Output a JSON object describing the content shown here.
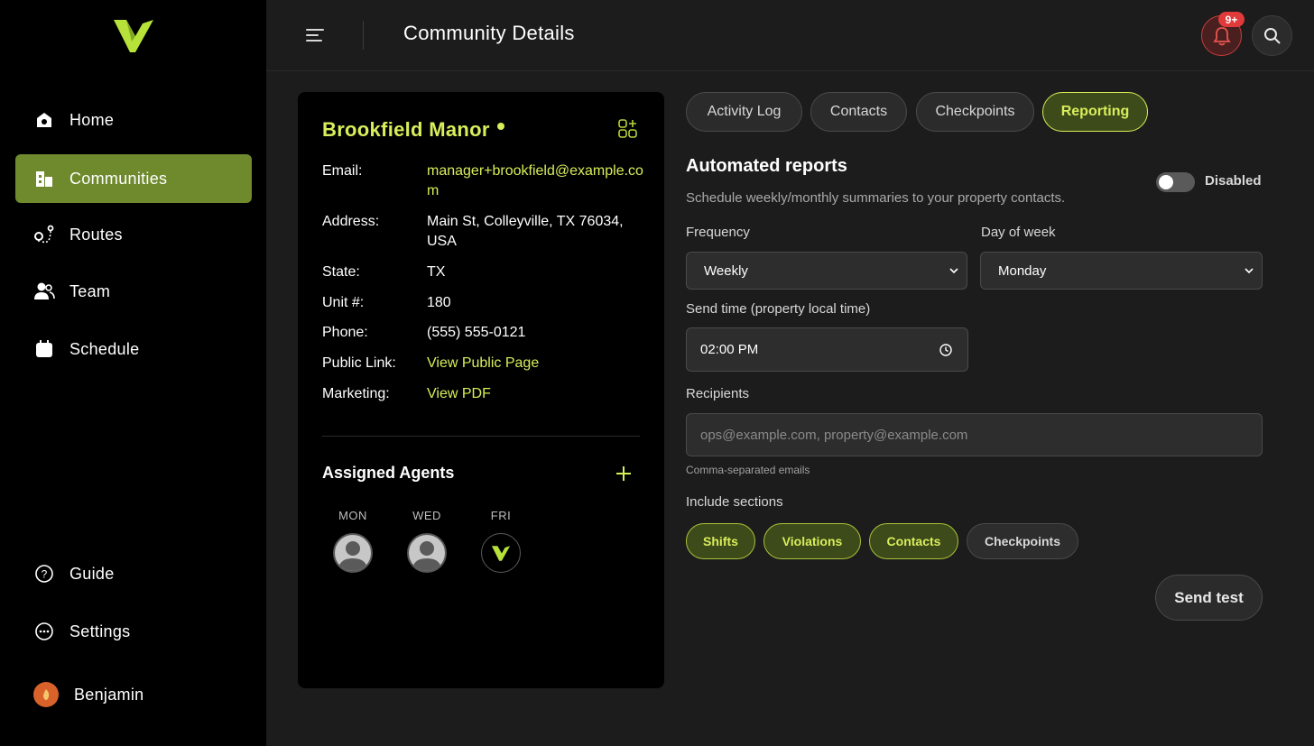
{
  "sidebar": {
    "logo": "brand-logo",
    "items": [
      {
        "label": "Home",
        "icon": "home-icon"
      },
      {
        "label": "Communities",
        "icon": "building-icon"
      },
      {
        "label": "Routes",
        "icon": "route-icon"
      },
      {
        "label": "Team",
        "icon": "team-icon"
      },
      {
        "label": "Schedule",
        "icon": "calendar-icon"
      }
    ],
    "bottom_items": [
      {
        "label": "Guide",
        "icon": "help-icon"
      },
      {
        "label": "Settings",
        "icon": "settings-icon"
      }
    ],
    "user": {
      "name": "Benjamin"
    }
  },
  "header": {
    "title": "Community Details",
    "notification_badge": "9+"
  },
  "community": {
    "name": "Brookfield Manor",
    "status": "online",
    "details": [
      {
        "label": "Email:",
        "value": "manager+brookfield@example.com",
        "link": true
      },
      {
        "label": "Address:",
        "value": "Main St, Colleyville, TX 76034, USA",
        "link": false
      },
      {
        "label": "State:",
        "value": "TX",
        "link": false
      },
      {
        "label": "Unit #:",
        "value": "180",
        "link": false
      },
      {
        "label": "Phone:",
        "value": "(555) 555-0121",
        "link": false
      },
      {
        "label": "Public Link:",
        "value": "View Public Page",
        "link": true
      },
      {
        "label": "Marketing:",
        "value": "View PDF",
        "link": true
      }
    ],
    "agents_title": "Assigned Agents",
    "agents": [
      {
        "day": "MON",
        "type": "person"
      },
      {
        "day": "WED",
        "type": "person"
      },
      {
        "day": "FRI",
        "type": "brand"
      }
    ]
  },
  "tabs": [
    {
      "label": "Activity Log",
      "active": false
    },
    {
      "label": "Contacts",
      "active": false
    },
    {
      "label": "Checkpoints",
      "active": false
    },
    {
      "label": "Reporting",
      "active": true
    }
  ],
  "reporting": {
    "title": "Automated reports",
    "subtitle": "Schedule weekly/monthly summaries to your property contacts.",
    "toggle_label": "Disabled",
    "enabled": false,
    "frequency_label": "Frequency",
    "frequency_value": "Weekly",
    "day_label": "Day of week",
    "day_value": "Monday",
    "send_time_label": "Send time (property local time)",
    "send_time_value": "02:00 PM",
    "recipients_label": "Recipients",
    "recipients_placeholder": "ops@example.com, property@example.com",
    "recipients_hint": "Comma-separated emails",
    "sections_label": "Include sections",
    "sections": [
      {
        "label": "Shifts",
        "selected": true
      },
      {
        "label": "Violations",
        "selected": true
      },
      {
        "label": "Contacts",
        "selected": true
      },
      {
        "label": "Checkpoints",
        "selected": false
      }
    ],
    "send_test_label": "Send test"
  },
  "colors": {
    "accent": "#d8ee5a",
    "active_nav": "#6e8a2d",
    "background": "#1c1c1c",
    "sidebar": "#000000",
    "alert": "#e03a3a"
  }
}
